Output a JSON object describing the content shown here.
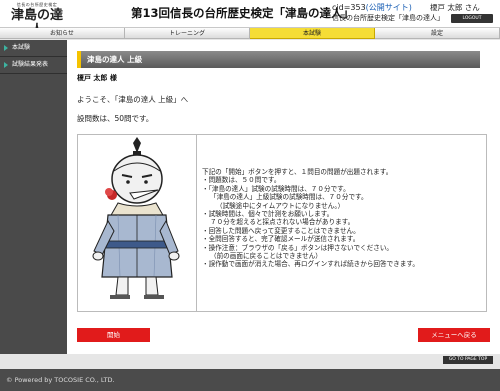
{
  "header": {
    "logo_small": "信長の台所歴史検定",
    "logo_big": "津島の達人",
    "title": "第13回信長の台所歴史検定「津島の達人」",
    "cid_label": "cid=353",
    "cid_public": "(公開サイト)",
    "subtitle": "信長の台所歴史検定「津島の達人」",
    "user_name": "榎戸 太郎 さん",
    "logout_label": "LOGOUT"
  },
  "nav": {
    "tabs": [
      {
        "label": "お知らせ",
        "active": false
      },
      {
        "label": "トレーニング",
        "active": false
      },
      {
        "label": "本試験",
        "active": true
      },
      {
        "label": "設定",
        "active": false
      }
    ]
  },
  "sidebar": {
    "items": [
      {
        "label": "本試験"
      },
      {
        "label": "試験結果発表"
      }
    ]
  },
  "main": {
    "section_title": "津島の達人 上級",
    "user_line": "榎戸 太郎 様",
    "welcome": "ようこそ、「津島の達人 上級」へ",
    "question_count": "設問数は、50問です。",
    "instructions": [
      "下記の「開始」ボタンを押すと、１問目の問題が出題されます。",
      "・問題数は、５０問です。",
      "・「津島の達人」試験の試験時間は、７０分です。",
      "「津島の達人」上級試験の試験時間は、７０分です。",
      "（試験途中にタイムアウトになりません。）",
      "・試験時間は、個々で計測をお願いします。",
      "７０分を超えると採点されない場合があります。",
      "・回答した問題へ戻って変更することはできません。",
      "・全問回答すると、完了確認メールが送信されます。",
      "・操作注意：ブラウザの「戻る」ボタンは押さないでください。",
      "（前の画面に戻ることはできません）",
      "・誤作動で画面が消えた場合、再ログインすれば続きから回答できます。"
    ],
    "start_label": "開始",
    "menu_label": "メニューへ戻る"
  },
  "pagetop_label": "GO TO PAGE TOP",
  "footer": {
    "copyright": "© Powered by TOCOSIE CO., LTD."
  },
  "colors": {
    "accent_red": "#e11b1b",
    "tab_active": "#f5dd36",
    "sidebar": "#4a4a4a",
    "footer": "#4b4b4b"
  }
}
